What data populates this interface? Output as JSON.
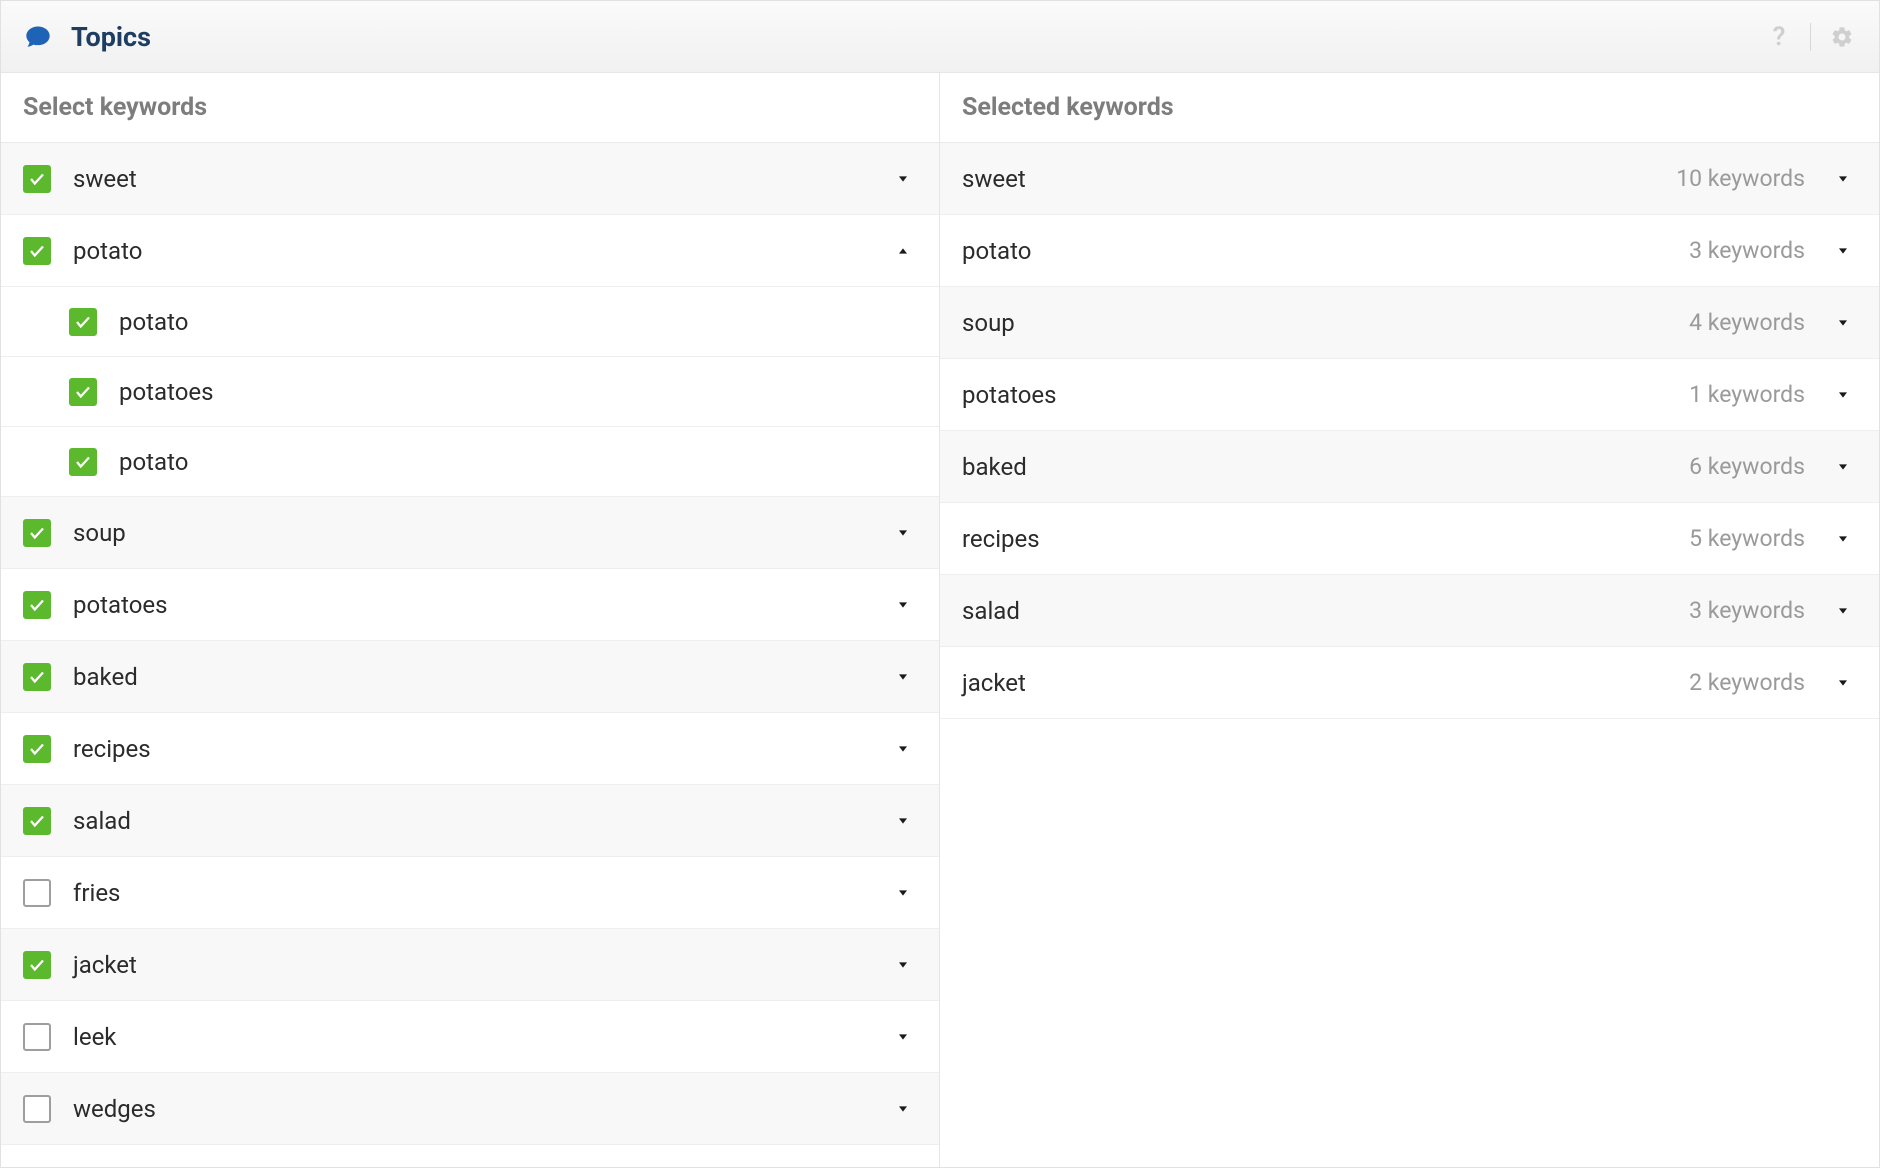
{
  "header": {
    "title": "Topics"
  },
  "left": {
    "heading": "Select keywords",
    "items": [
      {
        "label": "sweet",
        "checked": true,
        "expanded": false,
        "children": []
      },
      {
        "label": "potato",
        "checked": true,
        "expanded": true,
        "children": [
          {
            "label": "potato",
            "checked": true
          },
          {
            "label": "potatoes",
            "checked": true
          },
          {
            "label": "potato",
            "checked": true
          }
        ]
      },
      {
        "label": "soup",
        "checked": true,
        "expanded": false,
        "children": []
      },
      {
        "label": "potatoes",
        "checked": true,
        "expanded": false,
        "children": []
      },
      {
        "label": "baked",
        "checked": true,
        "expanded": false,
        "children": []
      },
      {
        "label": "recipes",
        "checked": true,
        "expanded": false,
        "children": []
      },
      {
        "label": "salad",
        "checked": true,
        "expanded": false,
        "children": []
      },
      {
        "label": "fries",
        "checked": false,
        "expanded": false,
        "children": []
      },
      {
        "label": "jacket",
        "checked": true,
        "expanded": false,
        "children": []
      },
      {
        "label": "leek",
        "checked": false,
        "expanded": false,
        "children": []
      },
      {
        "label": "wedges",
        "checked": false,
        "expanded": false,
        "children": []
      }
    ]
  },
  "right": {
    "heading": "Selected keywords",
    "count_suffix": "keywords",
    "items": [
      {
        "label": "sweet",
        "count": 10
      },
      {
        "label": "potato",
        "count": 3
      },
      {
        "label": "soup",
        "count": 4
      },
      {
        "label": "potatoes",
        "count": 1
      },
      {
        "label": "baked",
        "count": 6
      },
      {
        "label": "recipes",
        "count": 5
      },
      {
        "label": "salad",
        "count": 3
      },
      {
        "label": "jacket",
        "count": 2
      }
    ]
  }
}
